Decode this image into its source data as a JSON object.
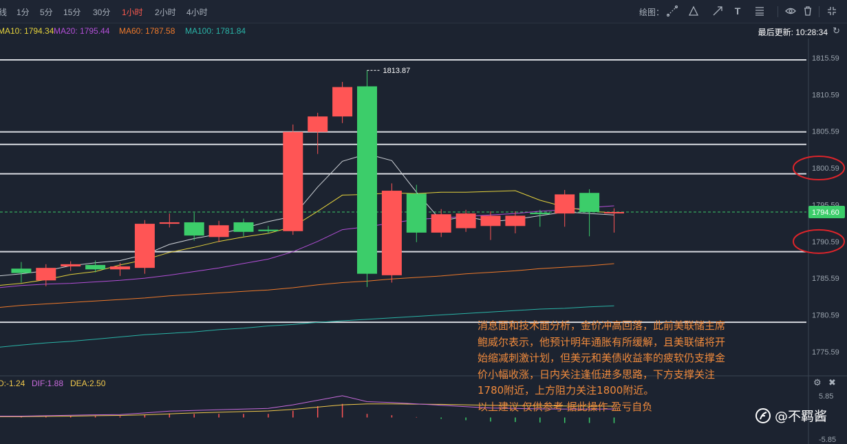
{
  "toolbar": {
    "timeframes": [
      {
        "label": "线",
        "active": false
      },
      {
        "label": "1分",
        "active": false
      },
      {
        "label": "5分",
        "active": false
      },
      {
        "label": "15分",
        "active": false
      },
      {
        "label": "30分",
        "active": false
      },
      {
        "label": "1小时",
        "active": true
      },
      {
        "label": "2小时",
        "active": false
      },
      {
        "label": "4小时",
        "active": false
      }
    ],
    "draw_label": "绘图：",
    "tools": [
      "line-tool-icon",
      "triangle-tool-icon",
      "arrow-tool-icon",
      "text-tool",
      "fib-tool-icon",
      "eye-icon",
      "trash-icon",
      "collapse-icon"
    ]
  },
  "ma_bar": {
    "items": [
      {
        "label": "MA10: 1794.34",
        "color": "#e6d33c"
      },
      {
        "label": "MA20: 1795.44",
        "color": "#b44fd8"
      },
      {
        "label": "MA60: 1787.58",
        "color": "#f07a2a"
      },
      {
        "label": "MA100: 1781.84",
        "color": "#2ab5a8"
      }
    ],
    "last_update": "最后更新: 10:28:34"
  },
  "macd_bar": {
    "items": [
      {
        "label": "D:-1.24",
        "color": "#f2c94c"
      },
      {
        "label": "DIF:1.88",
        "color": "#c86bdc"
      },
      {
        "label": "DEA:2.50",
        "color": "#f2c94c"
      }
    ]
  },
  "colors": {
    "up": "#ff5555",
    "down": "#3ccd6a",
    "ma_white": "#cfd3d8",
    "ma10": "#e6d33c",
    "ma20": "#b44fd8",
    "ma60": "#f07a2a",
    "ma100": "#2ab5a8",
    "circle": "#e0242a"
  },
  "chart_data": {
    "type": "candlestick",
    "price_axis": {
      "ticks": [
        1815.59,
        1810.59,
        1805.59,
        1800.59,
        1795.59,
        1790.59,
        1785.59,
        1780.59,
        1775.59
      ],
      "ylim": [
        1772.5,
        1818.2
      ],
      "current_price": 1794.6
    },
    "candles": [
      {
        "o": 1786.9,
        "c": 1786.3,
        "h": 1787.8,
        "l": 1785.0
      },
      {
        "o": 1785.3,
        "c": 1787.0,
        "h": 1787.5,
        "l": 1784.5
      },
      {
        "o": 1787.2,
        "c": 1787.5,
        "h": 1787.9,
        "l": 1786.6
      },
      {
        "o": 1787.4,
        "c": 1786.8,
        "h": 1788.0,
        "l": 1786.4
      },
      {
        "o": 1786.8,
        "c": 1787.2,
        "h": 1787.7,
        "l": 1785.9
      },
      {
        "o": 1787.0,
        "c": 1793.0,
        "h": 1793.5,
        "l": 1786.2
      },
      {
        "o": 1793.0,
        "c": 1793.2,
        "h": 1794.4,
        "l": 1792.5
      },
      {
        "o": 1793.2,
        "c": 1791.4,
        "h": 1794.5,
        "l": 1790.7
      },
      {
        "o": 1791.2,
        "c": 1792.8,
        "h": 1793.4,
        "l": 1790.5
      },
      {
        "o": 1793.2,
        "c": 1791.9,
        "h": 1793.7,
        "l": 1791.3
      },
      {
        "o": 1792.2,
        "c": 1792.0,
        "h": 1792.7,
        "l": 1791.7
      },
      {
        "o": 1792.0,
        "c": 1805.5,
        "h": 1806.5,
        "l": 1791.5
      },
      {
        "o": 1805.5,
        "c": 1807.6,
        "h": 1808.1,
        "l": 1802.5
      },
      {
        "o": 1807.6,
        "c": 1811.6,
        "h": 1812.3,
        "l": 1806.7
      },
      {
        "o": 1811.7,
        "c": 1786.2,
        "h": 1813.87,
        "l": 1784.4
      },
      {
        "o": 1786.0,
        "c": 1797.5,
        "h": 1798.5,
        "l": 1785.0
      },
      {
        "o": 1797.1,
        "c": 1791.8,
        "h": 1798.3,
        "l": 1790.5
      },
      {
        "o": 1791.8,
        "c": 1794.3,
        "h": 1795.0,
        "l": 1791.2
      },
      {
        "o": 1792.4,
        "c": 1794.4,
        "h": 1794.9,
        "l": 1791.9
      },
      {
        "o": 1792.7,
        "c": 1794.1,
        "h": 1794.7,
        "l": 1790.8
      },
      {
        "o": 1792.7,
        "c": 1794.1,
        "h": 1794.7,
        "l": 1791.7
      },
      {
        "o": 1794.5,
        "c": 1794.4,
        "h": 1794.9,
        "l": 1792.6
      },
      {
        "o": 1794.4,
        "c": 1797.0,
        "h": 1797.6,
        "l": 1792.6
      },
      {
        "o": 1797.2,
        "c": 1794.6,
        "h": 1797.7,
        "l": 1791.3
      },
      {
        "o": 1794.6,
        "c": 1794.6,
        "h": 1795.1,
        "l": 1791.8
      }
    ],
    "ma_white": [
      1786.2,
      1786.6,
      1787.3,
      1787.7,
      1788.0,
      1788.8,
      1790.2,
      1791.0,
      1791.6,
      1792.4,
      1793.3,
      1794.0,
      1798.0,
      1801.5,
      1802.5,
      1801.6,
      1797.3,
      1793.4,
      1794.0,
      1793.3,
      1793.6,
      1794.1,
      1794.6,
      1794.4,
      1794.2
    ],
    "ma10": [
      1784.9,
      1785.4,
      1786.1,
      1786.5,
      1787.4,
      1788.1,
      1789.1,
      1789.8,
      1790.6,
      1791.2,
      1791.7,
      1792.6,
      1794.7,
      1796.9,
      1797.0,
      1797.2,
      1797.1,
      1797.3,
      1797.3,
      1797.4,
      1797.5,
      1796.2,
      1795.3,
      1794.7,
      1794.5
    ],
    "ma20": [
      1784.6,
      1784.8,
      1784.9,
      1785.1,
      1785.3,
      1785.6,
      1786.0,
      1786.5,
      1787.0,
      1787.6,
      1788.2,
      1789.2,
      1790.6,
      1792.2,
      1792.6,
      1793.1,
      1793.6,
      1793.8,
      1794.0,
      1794.2,
      1794.4,
      1794.7,
      1794.9,
      1795.2,
      1795.44
    ],
    "ma60": [
      1781.9,
      1782.1,
      1782.3,
      1782.5,
      1782.7,
      1782.9,
      1783.2,
      1783.4,
      1783.6,
      1783.8,
      1784.0,
      1784.3,
      1784.7,
      1785.0,
      1785.2,
      1785.5,
      1785.7,
      1785.9,
      1786.2,
      1786.4,
      1786.6,
      1786.9,
      1787.1,
      1787.3,
      1787.58
    ],
    "ma100": [
      1776.5,
      1776.8,
      1777.0,
      1777.3,
      1777.6,
      1777.9,
      1778.1,
      1778.3,
      1778.6,
      1778.8,
      1779.1,
      1779.3,
      1779.6,
      1779.8,
      1780.0,
      1780.2,
      1780.4,
      1780.6,
      1780.8,
      1781.0,
      1781.2,
      1781.4,
      1781.5,
      1781.7,
      1781.84
    ],
    "horizontal_levels": [
      1815.3,
      1805.5,
      1803.8,
      1799.8,
      1789.2,
      1779.6
    ],
    "circled_levels": [
      1800.59,
      1790.59
    ],
    "high_label": "1813.87",
    "current_price_label": "1794.60",
    "macd": {
      "ticks": [
        "5.85",
        "-5.85"
      ],
      "dif": [
        0.3,
        0.4,
        0.5,
        0.6,
        0.65,
        1.0,
        1.4,
        1.55,
        1.7,
        1.85,
        2.0,
        2.8,
        3.8,
        4.8,
        3.5,
        3.3,
        3.0,
        2.7,
        2.4,
        2.1,
        2.0,
        1.9,
        1.85,
        1.85,
        1.88
      ],
      "dea": [
        0.2,
        0.25,
        0.3,
        0.4,
        0.45,
        0.6,
        0.8,
        1.0,
        1.15,
        1.3,
        1.45,
        1.8,
        2.3,
        2.8,
        3.0,
        3.0,
        2.95,
        2.9,
        2.8,
        2.7,
        2.65,
        2.6,
        2.55,
        2.52,
        2.5
      ],
      "hist": [
        0.2,
        0.2,
        0.3,
        0.3,
        0.3,
        0.6,
        0.9,
        0.8,
        0.8,
        0.8,
        0.8,
        1.5,
        2.5,
        3.0,
        0.8,
        0.5,
        0.1,
        -0.3,
        -0.6,
        -0.9,
        -1.0,
        -1.1,
        -1.2,
        -1.2,
        -1.24
      ]
    }
  },
  "annotation": {
    "lines": [
      "消息面和技术面分析，金价冲高回落，此前美联储主席",
      "鲍威尔表示，他预计明年通胀有所缓解，且美联储将开",
      "始缩减刺激计划，但美元和美债收益率的疲软仍支撑金",
      "价小幅收涨，日内关注逢低进多思路，下方支撑关注",
      "1780附近，上方阻力关注1800附近。",
      "以上建议 仅供参考 据此操作 盈亏自负"
    ]
  },
  "watermark": {
    "text": "@不羁酱"
  }
}
